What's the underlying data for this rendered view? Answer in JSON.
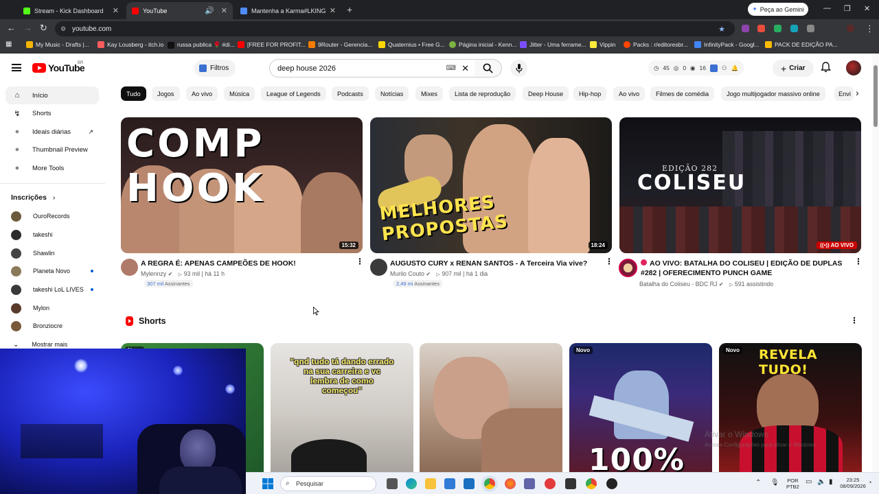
{
  "browser": {
    "tabs": [
      {
        "title": "Stream - Kick Dashboard",
        "favicon_color": "#53fc18"
      },
      {
        "title": "YouTube",
        "favicon_color": "#ff0000"
      },
      {
        "title": "Mantenha a Karma#LKING - Ab",
        "favicon_color": "#4f8cf7"
      }
    ],
    "gemini_label": "Peça ao Gemini",
    "url": "youtube.com",
    "bookmarks": [
      {
        "label": "My Music - Drafts |...",
        "color": "#f4b400"
      },
      {
        "label": "Kay Lousberg - itch.io",
        "color": "#fa5c5c"
      },
      {
        "label": "russa publica 🌹 #di...",
        "color": "#111111"
      },
      {
        "label": "[FREE FOR PROFIT...",
        "color": "#ff0000"
      },
      {
        "label": "9Router - Gerencia...",
        "color": "#f57c00"
      },
      {
        "label": "Quaternius • Free G...",
        "color": "#ffd600"
      },
      {
        "label": "Página inicial - Kenn...",
        "color": "#7cb342"
      },
      {
        "label": "Jitter - Uma ferrame...",
        "color": "#7c4dff"
      },
      {
        "label": "Vippin",
        "color": "#ffeb3b"
      },
      {
        "label": "Packs : r/editoresbr...",
        "color": "#ff4500"
      },
      {
        "label": "InfinityPack - Googl...",
        "color": "#4285f4"
      },
      {
        "label": "PACK DE EDIÇÃO PA...",
        "color": "#fbbc04"
      }
    ]
  },
  "header": {
    "logo_text": "YouTube",
    "country_code": "BR",
    "filters_label": "Filtros",
    "search_value": "deep house 2026",
    "ext_stats": [
      "45",
      "0",
      "16"
    ],
    "create_label": "Criar"
  },
  "sidebar": {
    "main": [
      {
        "label": "Início",
        "icon": "home-icon"
      },
      {
        "label": "Shorts",
        "icon": "shorts-icon"
      },
      {
        "label": "Ideais diárias",
        "icon": "lightbulb-icon"
      },
      {
        "label": "Thumbnail Preview",
        "icon": "preview-icon"
      },
      {
        "label": "More Tools",
        "icon": "tools-icon"
      }
    ],
    "subs_heading": "Inscrições",
    "subscriptions": [
      {
        "name": "OuroRecords",
        "color": "#6b5a3b",
        "dot": false
      },
      {
        "name": "takeshi",
        "color": "#2b2b2b",
        "dot": false
      },
      {
        "name": "Shawlin",
        "color": "#444444",
        "dot": false
      },
      {
        "name": "Planeta Novo",
        "color": "#8a7a5a",
        "dot": true
      },
      {
        "name": "takeshi LoL LIVES",
        "color": "#3a3a3a",
        "dot": true
      },
      {
        "name": "Mylon",
        "color": "#5a3b2b",
        "dot": false
      },
      {
        "name": "Bronziocre",
        "color": "#7a5a3a",
        "dot": false
      }
    ],
    "show_more": "Mostrar mais"
  },
  "chips": [
    "Tudo",
    "Jogos",
    "Ao vivo",
    "Música",
    "League of Legends",
    "Podcasts",
    "Notícias",
    "Mixes",
    "Lista de reprodução",
    "Deep House",
    "Hip-hop",
    "Ao vivo",
    "Filmes de comédia",
    "Jogo multijogador massivo online",
    "Envi"
  ],
  "videos": [
    {
      "thumb_text": "COMP HOOK",
      "duration": "15:32",
      "title": "A REGRA É: APENAS CAMPEÕES DE HOOK!",
      "channel": "Mylennzy",
      "views": "93 mil",
      "age": "há 11 h",
      "subs_num": "307 mil",
      "subs_label": "Assinantes"
    },
    {
      "thumb_text": "MELHORES PROPOSTAS",
      "duration": "18:24",
      "title": "AUGUSTO CURY x RENAN SANTOS - A Terceira Via vive?",
      "channel": "Murilo Couto",
      "views": "907 mil",
      "age": "há 1 dia",
      "subs_num": "2,49 mi",
      "subs_label": "Assinantes"
    },
    {
      "thumb_top": "EDIÇÃO 282",
      "thumb_text": "COLISEU",
      "live_label": "AO VIVO",
      "title": "AO VIVO: BATALHA DO COLISEU | EDIÇÃO DE DUPLAS #282 | OFERECIMENTO PUNCH GAME",
      "channel": "Batalha do Coliseu - BDC RJ",
      "watching": "591 assistindo"
    }
  ],
  "shorts": {
    "heading": "Shorts",
    "items": [
      {
        "caption": "",
        "badge": "Novo"
      },
      {
        "caption": "\"qnd tudo tá dando errado na sua carreira e vc lembra de como começou\"",
        "badge": ""
      },
      {
        "caption": "",
        "badge": ""
      },
      {
        "caption": "100%",
        "badge": "Novo"
      },
      {
        "caption": "REVELA TUDO!",
        "badge": "Novo"
      }
    ]
  },
  "windows": {
    "activate_title": "Ativar o Windows",
    "activate_sub": "Acesse Configurações para ativar o Windows.",
    "search_placeholder": "Pesquisar",
    "lang": "POR",
    "layout": "PTB2",
    "time": "23:25",
    "date": "08/09/2026"
  }
}
